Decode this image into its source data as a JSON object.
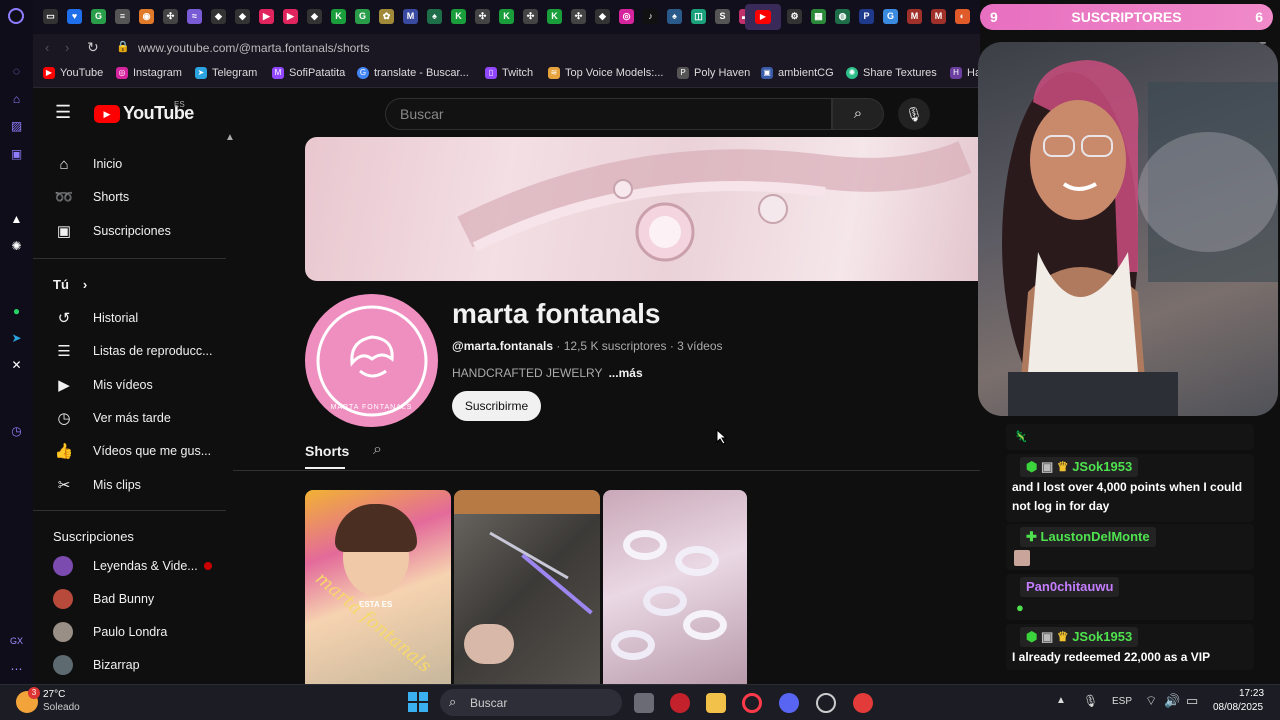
{
  "browser": {
    "url": "www.youtube.com/@marta.fontanals/shorts",
    "bookmarks": [
      {
        "label": "YouTube",
        "color": "#ff0000"
      },
      {
        "label": "Instagram",
        "color": "#d6249f"
      },
      {
        "label": "Telegram",
        "color": "#2aa3e0"
      },
      {
        "label": "SofiPatatita",
        "color": "#9146ff"
      },
      {
        "label": "translate - Buscar...",
        "color": "#4285f4"
      },
      {
        "label": "Twitch",
        "color": "#9146ff"
      },
      {
        "label": "Top Voice Models:...",
        "color": "#e6a23c"
      },
      {
        "label": "Poly Haven",
        "color": "#555555"
      },
      {
        "label": "ambientCG",
        "color": "#3a5ca8"
      },
      {
        "label": "Share Textures",
        "color": "#2dbf8a"
      },
      {
        "label": "Ha",
        "color": "#6b3fa0"
      }
    ]
  },
  "youtube": {
    "logo_text": "YouTube",
    "region": "ES",
    "search_placeholder": "Buscar",
    "sidebar": {
      "main": [
        {
          "label": "Inicio",
          "icon": "home-icon"
        },
        {
          "label": "Shorts",
          "icon": "shorts-icon"
        },
        {
          "label": "Suscripciones",
          "icon": "subscriptions-icon"
        }
      ],
      "you_heading": "Tú",
      "you_items": [
        {
          "label": "Historial",
          "icon": "history-icon"
        },
        {
          "label": "Listas de reproducc...",
          "icon": "playlists-icon"
        },
        {
          "label": "Mis vídeos",
          "icon": "my-videos-icon"
        },
        {
          "label": "Ver más tarde",
          "icon": "watch-later-icon"
        },
        {
          "label": "Vídeos que me gus...",
          "icon": "liked-icon"
        },
        {
          "label": "Mis clips",
          "icon": "clips-icon"
        }
      ],
      "subs_heading": "Suscripciones",
      "subs": [
        {
          "label": "Leyendas & Vide...",
          "color": "#7b4bb0",
          "live": true
        },
        {
          "label": "Bad Bunny",
          "color": "#b84a3c",
          "live": false
        },
        {
          "label": "Paulo Londra",
          "color": "#9a8f86",
          "live": false
        },
        {
          "label": "Bizarrap",
          "color": "#5d6a70",
          "live": false
        }
      ]
    },
    "channel": {
      "name": "marta fontanals",
      "handle": "@marta.fontanals",
      "subscribers": "12,5 K suscriptores",
      "videos": "3 vídeos",
      "description": "HANDCRAFTED JEWELRY",
      "more": "...más",
      "subscribe_label": "Suscribirme",
      "avatar_text": "MARTA FONTANALS",
      "tab_active": "Shorts"
    },
    "shorts": [
      {
        "caption": "ESTA ES",
        "overlay": "marta fontanals"
      },
      {
        "caption": "",
        "overlay": ""
      },
      {
        "caption": "",
        "overlay": ""
      }
    ]
  },
  "overlay": {
    "subs_left": "9",
    "subs_title": "SUSCRIPTORES",
    "subs_right": "6",
    "chat": [
      {
        "user": "JSok1953",
        "text": "and I lost over 4,000 points when I could not log in for day",
        "user_color": "#4ee34e"
      },
      {
        "user": "LaustonDelMonte",
        "text": "",
        "user_color": "#4ee34e"
      },
      {
        "user": "Pan0chitauwu",
        "text": "",
        "user_color": "#c47dff"
      },
      {
        "user": "JSok1953",
        "text": "I already redeemed 22,000 as a VIP",
        "user_color": "#4ee34e"
      }
    ]
  },
  "taskbar": {
    "weather_temp": "27°C",
    "weather_desc": "Soleado",
    "weather_badge": "3",
    "search_placeholder": "Buscar",
    "language": "ESP",
    "time": "17:23",
    "date": "08/08/2025"
  }
}
